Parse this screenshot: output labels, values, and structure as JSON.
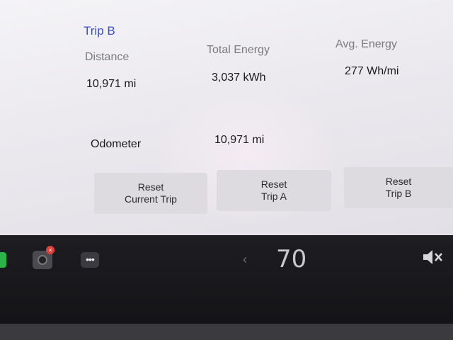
{
  "trip": {
    "title": "Trip B",
    "distance_label": "Distance",
    "distance_value": "10,971 mi",
    "total_energy_label": "Total Energy",
    "total_energy_value": "3,037 kWh",
    "avg_energy_label": "Avg. Energy",
    "avg_energy_value": "277 Wh/mi",
    "odometer_label": "Odometer",
    "odometer_value": "10,971 mi"
  },
  "buttons": {
    "reset_current_line1": "Reset",
    "reset_current_line2": "Current Trip",
    "reset_a_line1": "Reset",
    "reset_a_line2": "Trip A",
    "reset_b_line1": "Reset",
    "reset_b_line2": "Trip B"
  },
  "bottom_bar": {
    "temperature": "70",
    "chevron": "‹",
    "camera_badge": "×",
    "icons": [
      "phone-icon",
      "camera-icon",
      "more-dots-icon",
      "mute-icon"
    ]
  },
  "colors": {
    "title_blue": "#3a4fd0",
    "screen_bg": "#efeef2",
    "bar_bg": "#1b1b1f",
    "phone_green": "#2cb34a",
    "badge_red": "#e0403a"
  }
}
